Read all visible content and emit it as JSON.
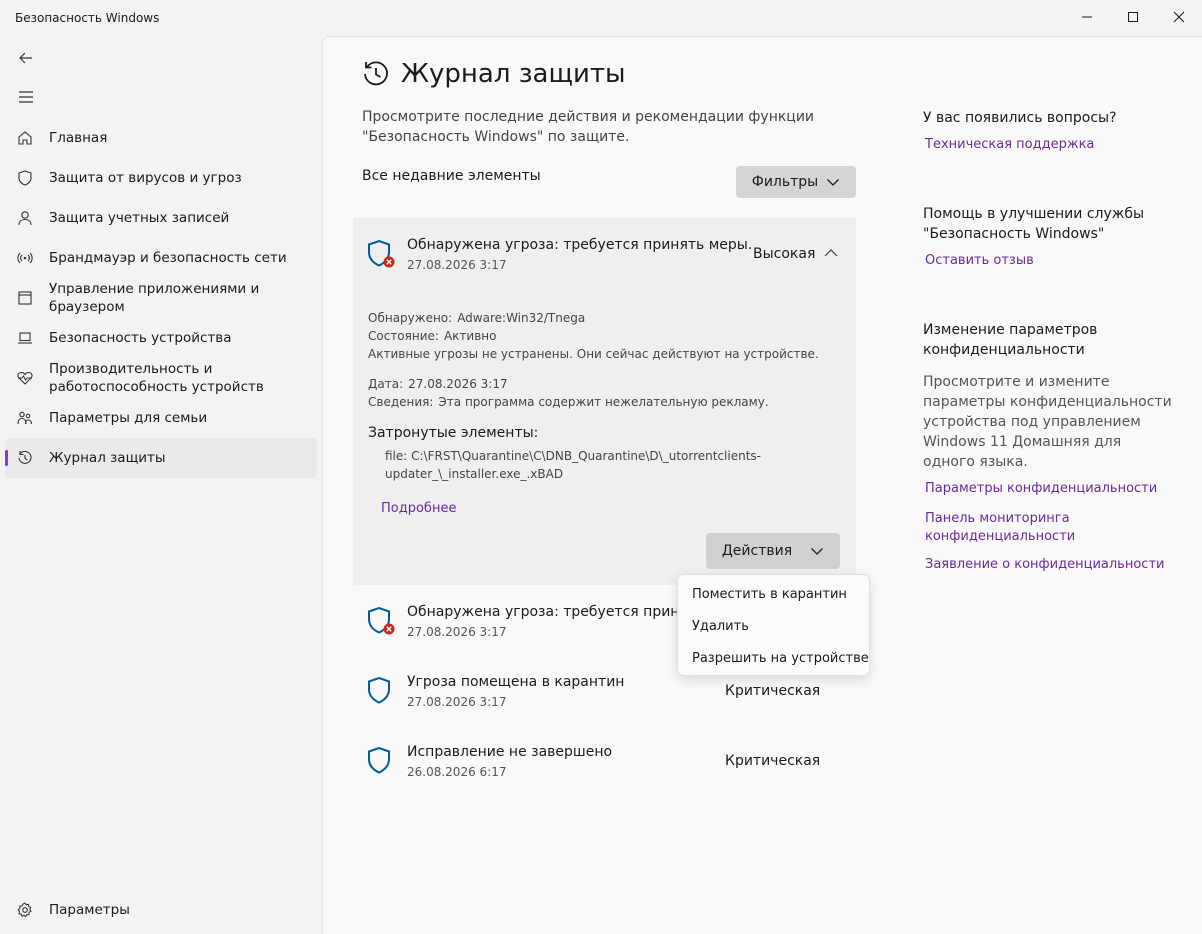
{
  "app": {
    "title": "Безопасность Windows",
    "controls": [
      "minimize",
      "maximize",
      "close"
    ]
  },
  "sidebar": {
    "items": [
      {
        "label": "Главная",
        "icon": "home-icon"
      },
      {
        "label": "Защита от вирусов и угроз",
        "icon": "shield-icon"
      },
      {
        "label": "Защита учетных записей",
        "icon": "person-icon"
      },
      {
        "label": "Брандмауэр и безопасность сети",
        "icon": "wireless-icon"
      },
      {
        "label": "Управление приложениями и браузером",
        "icon": "app-browser-icon"
      },
      {
        "label": "Безопасность устройства",
        "icon": "laptop-icon"
      },
      {
        "label": "Производительность и работоспособность устройств",
        "icon": "heart-pulse-icon"
      },
      {
        "label": "Параметры для семьи",
        "icon": "family-icon"
      },
      {
        "label": "Журнал защиты",
        "icon": "history-icon",
        "active": true
      }
    ],
    "settings_label": "Параметры"
  },
  "main": {
    "title": "Журнал защиты",
    "description": "Просмотрите последние действия и рекомендации функции \"Безопасность Windows\" по защите.",
    "recent_label": "Все недавние элементы",
    "filters_label": "Фильтры",
    "expanded": {
      "title": "Обнаружена угроза: требуется принять меры.",
      "date": "27.08.2026 3:17",
      "severity": "Высокая",
      "detected_key": "Обнаружено:",
      "detected_val": "Adware:Win32/Tnega",
      "status_key": "Состояние:",
      "status_val": "Активно",
      "status_note": "Активные угрозы не устранены. Они сейчас действуют на устройстве.",
      "date_key": "Дата:",
      "date_val": "27.08.2026 3:17",
      "info_key": "Сведения:",
      "info_val": "Эта программа содержит нежелательную рекламу.",
      "affected_title": "Затронутые элементы:",
      "affected_path": "file: C:\\FRST\\Quarantine\\C\\DNB_Quarantine\\D\\_utorrentclients-updater_\\_installer.exe_.xBAD",
      "more_label": "Подробнее",
      "actions_label": "Действия"
    },
    "rows": [
      {
        "title": "Обнаружена угроза: требуется принять",
        "date": "27.08.2026 3:17",
        "severity": "",
        "alert": true
      },
      {
        "title": "Угроза помещена в карантин",
        "date": "27.08.2026 3:17",
        "severity": "Критическая",
        "alert": false
      },
      {
        "title": "Исправление не завершено",
        "date": "26.08.2026 6:17",
        "severity": "Критическая",
        "alert": false
      }
    ],
    "actions_menu": [
      "Поместить в карантин",
      "Удалить",
      "Разрешить на устройстве"
    ]
  },
  "side": {
    "questions_title": "У вас появились вопросы?",
    "support_link": "Техническая поддержка",
    "improve_title": "Помощь в улучшении службы \"Безопасность Windows\"",
    "feedback_link": "Оставить отзыв",
    "privacy_title": "Изменение параметров конфиденциальности",
    "privacy_desc": "Просмотрите и измените параметры конфиденциальности устройства под управлением Windows 11 Домашняя для одного языка.",
    "privacy_links": [
      "Параметры конфиденциальности",
      "Панель мониторинга конфиденциальности",
      "Заявление о конфиденциальности"
    ]
  },
  "colors": {
    "accent": "#6b2b96",
    "shield": "#005a9e",
    "alert": "#c42b1c"
  }
}
